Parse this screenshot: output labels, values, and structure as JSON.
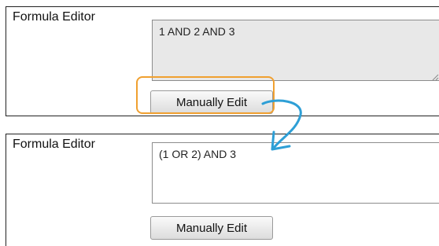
{
  "top_panel": {
    "label": "Formula Editor",
    "formula_value": "1 AND 2 AND 3",
    "button_label": "Manually Edit",
    "formula_readonly": true
  },
  "bottom_panel": {
    "label": "Formula Editor",
    "formula_value": "(1 OR 2) AND 3",
    "button_label": "Manually Edit",
    "formula_readonly": false
  },
  "colors": {
    "highlight": "#f0a030",
    "arrow": "#2e9fd6",
    "readonly_bg": "#e8e8e8"
  },
  "icons": {
    "transition": "curved-arrow-icon",
    "resize": "resize-grip-icon"
  }
}
